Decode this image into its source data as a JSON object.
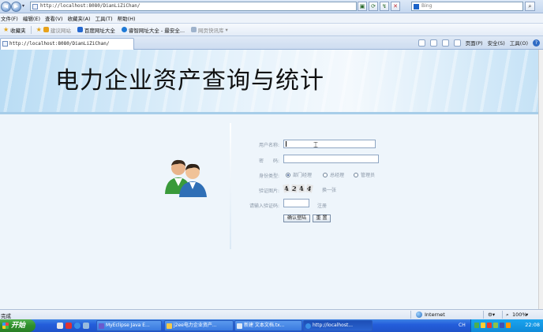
{
  "browser": {
    "address": "http://localhost:8080/DianLiZiChan/",
    "search_placeholder": "Bing",
    "menu": [
      "文件(F)",
      "编辑(E)",
      "查看(V)",
      "收藏夹(A)",
      "工具(T)",
      "帮助(H)"
    ],
    "favorites": {
      "label": "收藏夹",
      "items": [
        "建议网站",
        "百度网址大全",
        "睿智网址大全 - 最安全...",
        "网页快讯库"
      ]
    },
    "tab_title": "http://localhost:8080/DianLiZiChan/",
    "commands": [
      "页面(P)",
      "安全(S)",
      "工具(O)"
    ],
    "status": {
      "left": "完成",
      "zone": "Internet",
      "zoom": "100%"
    }
  },
  "page": {
    "title": "电力企业资产查询与统计",
    "form": {
      "username_label": "用户名称:",
      "username_value": "",
      "password_label": "密　　码:",
      "password_value": "",
      "role_label": "身份类型:",
      "roles": [
        "部门经理",
        "总经理",
        "管理员"
      ],
      "selected_role": "部门经理",
      "captcha_label": "验证图片:",
      "captcha_chars": [
        "4",
        "2",
        "4",
        "4"
      ],
      "refresh_link": "换一张",
      "captcha_input_label": "请输入验证码:",
      "captcha_input_value": "",
      "register_link": "注册",
      "submit_label": "确认登陆",
      "reset_label": "重 置"
    }
  },
  "taskbar": {
    "start_label": "开始",
    "tasks": [
      "MyEclipse Java E...",
      "j2ee电力企业资产...",
      "新建 文本文档.tx...",
      "http://localhost..."
    ],
    "active_task": "http://localhost...",
    "lang": "CH",
    "time": "22:08"
  },
  "colors": {
    "banner_blue": "#b9dcf4",
    "page_bg": "#eef5fb",
    "taskbar_blue": "#245edb",
    "start_green": "#2f8f2c"
  }
}
